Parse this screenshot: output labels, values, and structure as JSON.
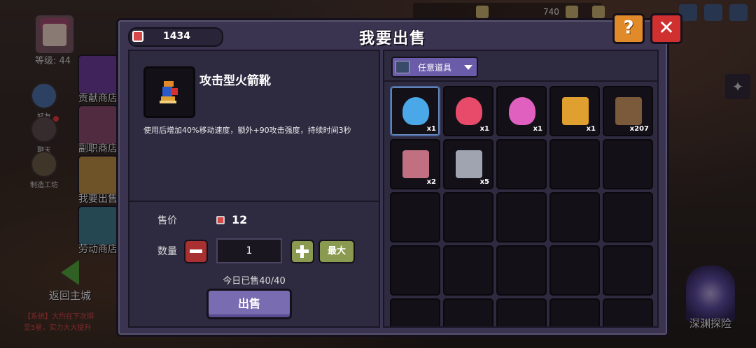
{
  "player": {
    "level_label": "等级: 44"
  },
  "sidebar": {
    "friends": "好友",
    "chat": "聊天",
    "workshop": "制造工坊"
  },
  "shops": [
    {
      "label": "贡献商店"
    },
    {
      "label": "副职商店"
    },
    {
      "label": "我要出售"
    },
    {
      "label": "劳动商店"
    }
  ],
  "back_label": "返回主城",
  "chat_log": [
    "【系统】大约在下次掷",
    "至5星，实力大大提升"
  ],
  "hud": {
    "coins": "740",
    "abyss_label": "深渊探险"
  },
  "dialog": {
    "title": "我要出售",
    "gems": "1434",
    "help": "?",
    "close": "✕",
    "item": {
      "name": "攻击型火箭靴",
      "description": "使用后增加40%移动速度，额外+90攻击强度，持续时间3秒"
    },
    "price_label": "售价",
    "price_value": "12",
    "qty_label": "数量",
    "qty_value": "1",
    "max_label": "最大",
    "sold_today": "今日已售40/40",
    "sell_button": "出售",
    "filter_label": "任意道具",
    "inventory": [
      {
        "name": "blue-potion",
        "count": "x1",
        "color": "#4aa8e8"
      },
      {
        "name": "red-potion",
        "count": "x1",
        "color": "#e84a6a"
      },
      {
        "name": "pink-potion",
        "count": "x1",
        "color": "#e060c0"
      },
      {
        "name": "rocket-boots",
        "count": "x1",
        "color": "#e0a030"
      },
      {
        "name": "boots-check",
        "count": "x207",
        "color": "#7a5a3a"
      },
      {
        "name": "ore-cart-pink",
        "count": "x2",
        "color": "#c07080"
      },
      {
        "name": "ore-cart-grey",
        "count": "x5",
        "color": "#a0a4b0"
      },
      {
        "name": "",
        "count": ""
      },
      {
        "name": "",
        "count": ""
      },
      {
        "name": "",
        "count": ""
      },
      {
        "name": "",
        "count": ""
      },
      {
        "name": "",
        "count": ""
      },
      {
        "name": "",
        "count": ""
      },
      {
        "name": "",
        "count": ""
      },
      {
        "name": "",
        "count": ""
      },
      {
        "name": "",
        "count": ""
      },
      {
        "name": "",
        "count": ""
      },
      {
        "name": "",
        "count": ""
      },
      {
        "name": "",
        "count": ""
      },
      {
        "name": "",
        "count": ""
      },
      {
        "name": "",
        "count": ""
      },
      {
        "name": "",
        "count": ""
      },
      {
        "name": "",
        "count": ""
      },
      {
        "name": "",
        "count": ""
      },
      {
        "name": "",
        "count": ""
      }
    ]
  }
}
